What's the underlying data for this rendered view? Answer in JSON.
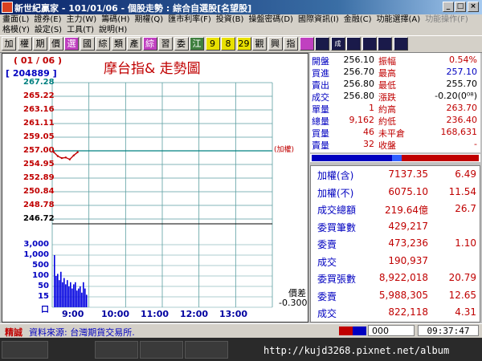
{
  "window": {
    "title": "新世紀贏家 - 101/01/06 - 個股走勢 : 綜合自選股[名望股]",
    "min": "_",
    "max": "□",
    "close": "×"
  },
  "menu1": [
    "畫面(L)",
    "證券(E)",
    "主力(W)",
    "籌碼(H)",
    "期權(Q)",
    "匯市利率(F)",
    "投資(B)",
    "操盤密碼(D)",
    "國際資訊(I)",
    "金融(C)",
    "功能選擇(A)",
    "功能操作(F)"
  ],
  "menu2": [
    "格模(Y)",
    "設定(S)",
    "工具(T)",
    "說明(H)"
  ],
  "toolbar": [
    "加",
    "權",
    "期",
    "價",
    "選",
    "國",
    "綜",
    "類",
    "產",
    "綜",
    "習",
    "委",
    "江",
    "9",
    "8",
    "29",
    "觀",
    "興",
    "指",
    "",
    "",
    "成",
    "",
    "",
    "",
    ""
  ],
  "chart": {
    "date": "( 01 / 06 )",
    "volume_total": "[ 204889 ]",
    "title": "摩台指&  走勢圖",
    "ref_label": "(加權)",
    "price_ticks": [
      "267.28",
      "265.22",
      "263.16",
      "261.11",
      "259.05",
      "257.00",
      "254.95",
      "252.89",
      "250.84",
      "248.78",
      "246.72"
    ],
    "vol_ticks": [
      "3,000",
      "1,000",
      "500",
      "100",
      "50",
      "15",
      "口"
    ],
    "time_ticks": [
      "9:00",
      "10:00",
      "11:00",
      "12:00",
      "13:00"
    ],
    "diff_label": "價差",
    "diff_value": "-0.300"
  },
  "chart_data": {
    "type": "line",
    "ylim": [
      246.72,
      267.28
    ],
    "reference": 257.0,
    "x": [
      "9:00",
      "9:05",
      "9:10",
      "9:15",
      "9:20",
      "9:25",
      "9:30"
    ],
    "series": [
      {
        "values": [
          256.8,
          256.2,
          255.9,
          256.0,
          255.7,
          256.3,
          256.8
        ]
      }
    ],
    "volume": [
      2500,
      1500,
      1600,
      1300,
      1700,
      1200,
      1400,
      1100,
      1300,
      1000,
      1200,
      900,
      1100,
      1200,
      800,
      900,
      1000,
      700,
      1200,
      900,
      600
    ]
  },
  "quote": {
    "rows": [
      {
        "l1": "開盤",
        "v1": "256.10",
        "l2": "振幅",
        "v2": "0.54%"
      },
      {
        "l1": "買進",
        "v1": "256.70",
        "l2": "最高",
        "v2": "257.10"
      },
      {
        "l1": "賣出",
        "v1": "256.80",
        "l2": "最低",
        "v2": "255.70"
      },
      {
        "l1": "成交",
        "v1": "256.80",
        "l2": "漲跌",
        "v2": "-0.20(0⁰⁸)"
      },
      {
        "l1": "單量",
        "v1": "1",
        "l2": "約高",
        "v2": "263.70"
      },
      {
        "l1": "總量",
        "v1": "9,162",
        "l2": "約低",
        "v2": "236.40"
      },
      {
        "l1": "買量",
        "v1": "46",
        "l2": "未平倉",
        "v2": "168,631"
      },
      {
        "l1": "賣量",
        "v1": "32",
        "l2": "收盤",
        "v2": "-"
      }
    ]
  },
  "stats": [
    {
      "label": "加權(含)",
      "value": "7137.35",
      "pct": "6.49"
    },
    {
      "label": "加權(不)",
      "value": "6075.10",
      "pct": "11.54"
    },
    {
      "label": "成交總額",
      "value": "219.64億",
      "pct": "26.7"
    },
    {
      "label": "委買筆數",
      "value": "429,217",
      "pct": ""
    },
    {
      "label": "委賣",
      "value": "473,236",
      "pct": "1.10"
    },
    {
      "label": "成交",
      "value": "190,937",
      "pct": ""
    },
    {
      "label": "委買張數",
      "value": "8,922,018",
      "pct": "20.79"
    },
    {
      "label": "委賣",
      "value": "5,988,305",
      "pct": "12.65"
    },
    {
      "label": "成交",
      "value": "822,118",
      "pct": "4.31"
    }
  ],
  "status": {
    "tag": "精誠",
    "source": "資料來源: 台灣期貨交易所.",
    "counter": "000",
    "time": "09:37:47"
  },
  "taskbar": {
    "url": "http://kujd3268.pixnet.net/album"
  },
  "colors": {
    "up": "#c00000",
    "down": "#0000c0",
    "grid": "#5a9ea0"
  }
}
